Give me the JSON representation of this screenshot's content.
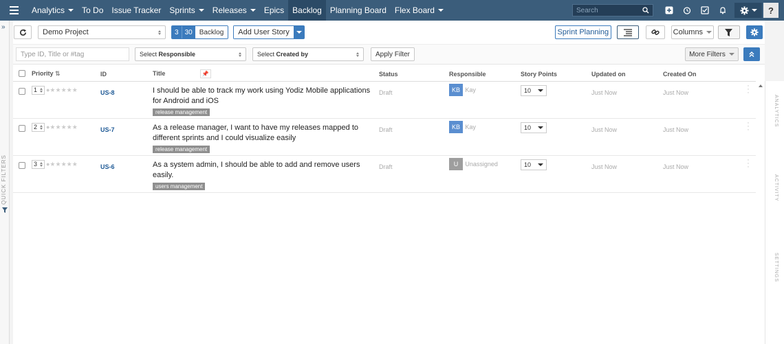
{
  "nav": {
    "items": [
      {
        "label": "Analytics",
        "caret": true
      },
      {
        "label": "To Do",
        "caret": false
      },
      {
        "label": "Issue Tracker",
        "caret": false
      },
      {
        "label": "Sprints",
        "caret": true
      },
      {
        "label": "Releases",
        "caret": true
      },
      {
        "label": "Epics",
        "caret": false
      },
      {
        "label": "Backlog",
        "caret": false,
        "active": true
      },
      {
        "label": "Planning Board",
        "caret": false
      },
      {
        "label": "Flex Board",
        "caret": true
      }
    ],
    "search_placeholder": "Search",
    "help_label": "?"
  },
  "quick_filters_label": "QUICK FILTERS",
  "toolbar": {
    "project": "Demo Project",
    "count_a": "3",
    "count_b": "30",
    "backlog_label": "Backlog",
    "add_story_label": "Add User Story",
    "sprint_planning_label": "Sprint Planning",
    "columns_label": "Columns"
  },
  "filters": {
    "search_placeholder": "Type ID, Title or #tag",
    "responsible_prefix": "Select",
    "responsible_bold": "Responsible",
    "created_prefix": "Select",
    "created_bold": "Created by",
    "apply_label": "Apply Filter",
    "more_label": "More Filters"
  },
  "table": {
    "headers": {
      "priority": "Priority",
      "id": "ID",
      "title": "Title",
      "status": "Status",
      "responsible": "Responsible",
      "story_points": "Story Points",
      "updated_on": "Updated on",
      "created_on": "Created On"
    },
    "rows": [
      {
        "priority": "1",
        "id": "US-8",
        "title_line1": "I should be able to track my work using Yodiz Mobile applications",
        "title_line2": "for Android and iOS",
        "tag": "release management",
        "status": "Draft",
        "avatar": "KB",
        "responsible": "Kay",
        "story_points": "10",
        "updated": "Just Now",
        "created": "Just Now"
      },
      {
        "priority": "2",
        "id": "US-7",
        "title_line1": "As a release manager, I want to have my releases mapped to",
        "title_line2": "different sprints and I could visualize easily",
        "tag": "release management",
        "status": "Draft",
        "avatar": "KB",
        "responsible": "Kay",
        "story_points": "10",
        "updated": "Just Now",
        "created": "Just Now"
      },
      {
        "priority": "3",
        "id": "US-6",
        "title_line1": "As a system admin, I should be able to add and remove users",
        "title_line2": "easily.",
        "tag": "users management",
        "status": "Draft",
        "avatar": "U",
        "responsible": "Unassigned",
        "story_points": "10",
        "updated": "Just Now",
        "created": "Just Now"
      }
    ]
  },
  "right_panel": {
    "analytics": "ANALYTICS",
    "activity": "ACTIVITY",
    "settings": "SETTINGS"
  }
}
